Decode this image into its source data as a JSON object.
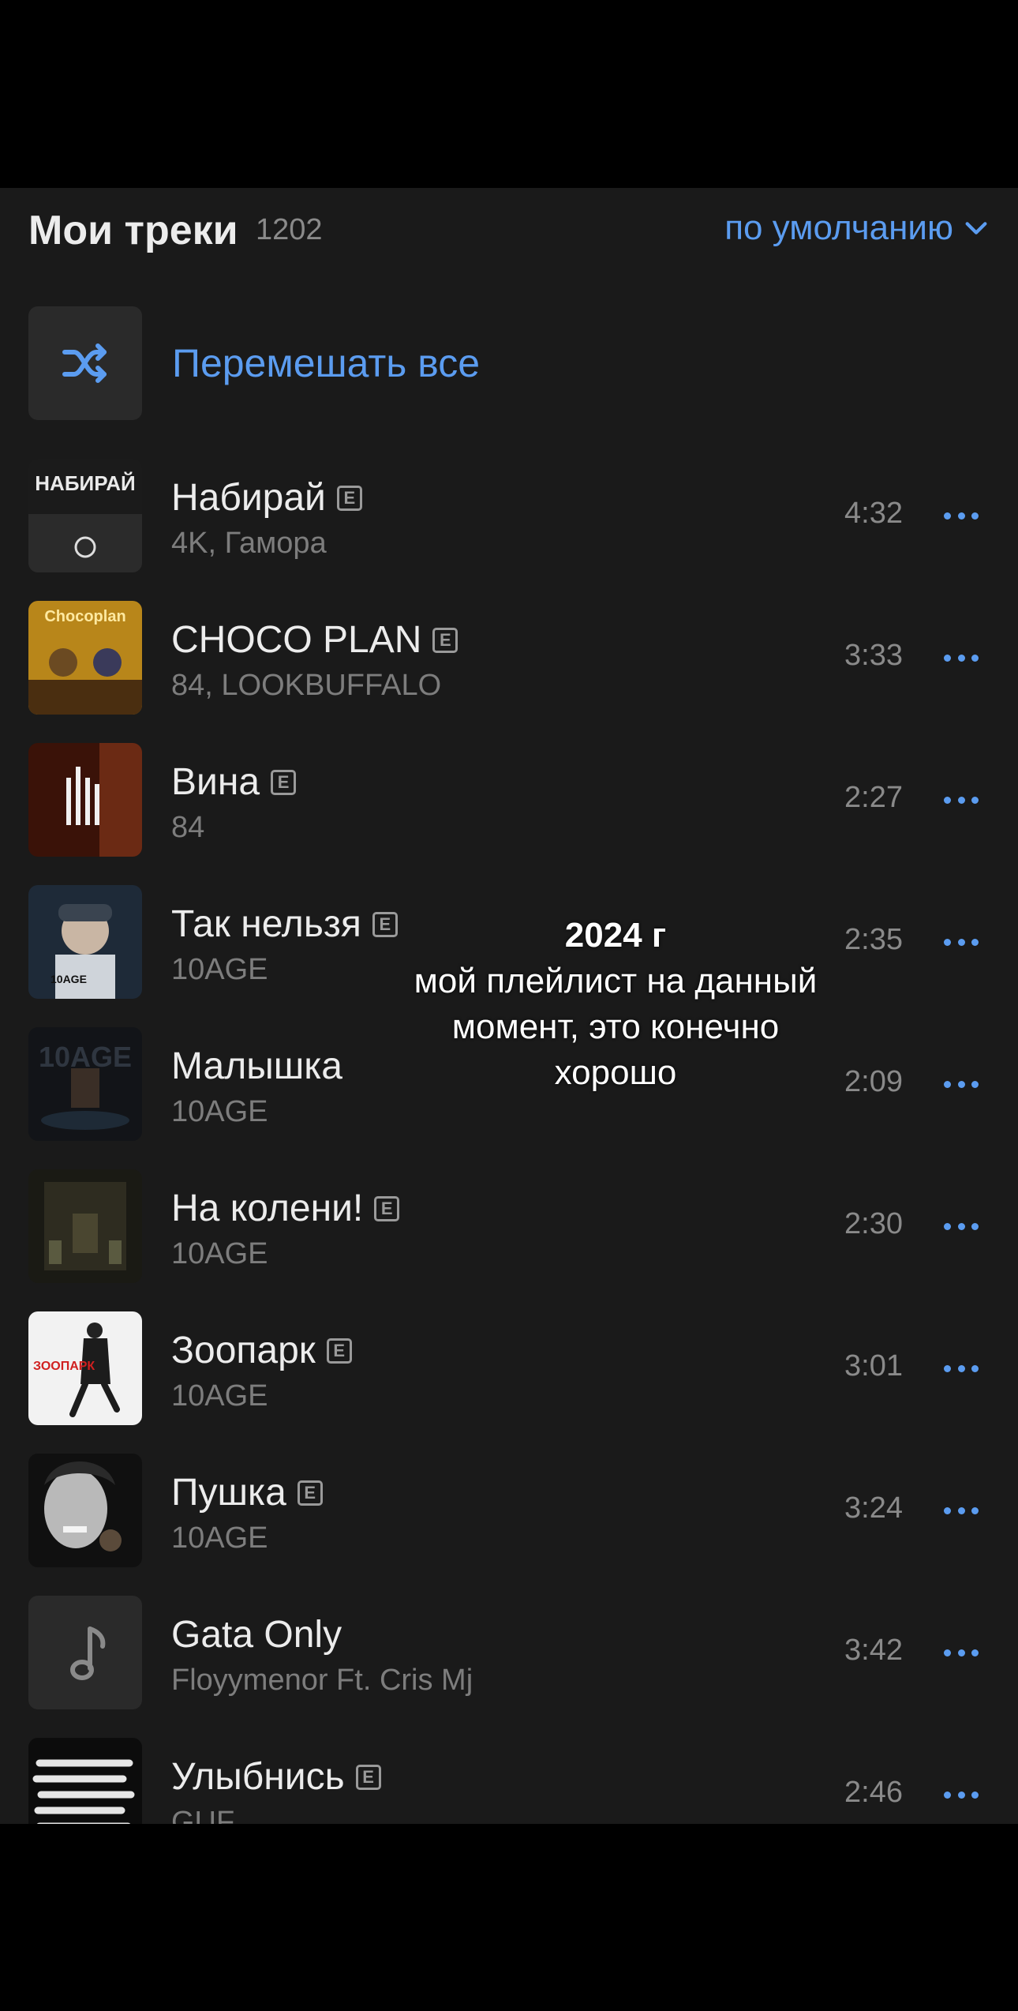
{
  "header": {
    "title": "Мои треки",
    "count": "1202",
    "sort_label": "по умолчанию"
  },
  "shuffle": {
    "label": "Перемешать все",
    "icon": "shuffle-icon"
  },
  "explicit_badge": "E",
  "tracks": [
    {
      "title": "Набирай",
      "artist": "4K, Гамора",
      "duration": "4:32",
      "explicit": true,
      "cover_text": "НАБИРАЙ"
    },
    {
      "title": "CHOCO PLAN",
      "artist": "84, LOOKBUFFALO",
      "duration": "3:33",
      "explicit": true,
      "cover_text": "Chocoplan"
    },
    {
      "title": "Вина",
      "artist": "84",
      "duration": "2:27",
      "explicit": true
    },
    {
      "title": "Так нельзя",
      "artist": "10AGE",
      "duration": "2:35",
      "explicit": true,
      "cover_text": "10AGE"
    },
    {
      "title": "Малышка",
      "artist": "10AGE",
      "duration": "2:09",
      "explicit": false,
      "cover_text": "10AGE"
    },
    {
      "title": "На колени!",
      "artist": "10AGE",
      "duration": "2:30",
      "explicit": true
    },
    {
      "title": "Зоопарк",
      "artist": "10AGE",
      "duration": "3:01",
      "explicit": true,
      "cover_text": "ЗООПАРК"
    },
    {
      "title": "Пушка",
      "artist": "10AGE",
      "duration": "3:24",
      "explicit": true
    },
    {
      "title": "Gata Only",
      "artist": "Floyymenor Ft. Cris Mj",
      "duration": "3:42",
      "explicit": false
    },
    {
      "title": "Улыбнись",
      "artist": "GUF",
      "duration": "2:46",
      "explicit": true
    }
  ],
  "overlay": {
    "line1": "2024 г",
    "line2": "мой плейлист на данный",
    "line3": "момент, это конечно",
    "line4": "хорошо"
  },
  "colors": {
    "accent": "#5b9cf0",
    "background": "#1a1a1a"
  }
}
